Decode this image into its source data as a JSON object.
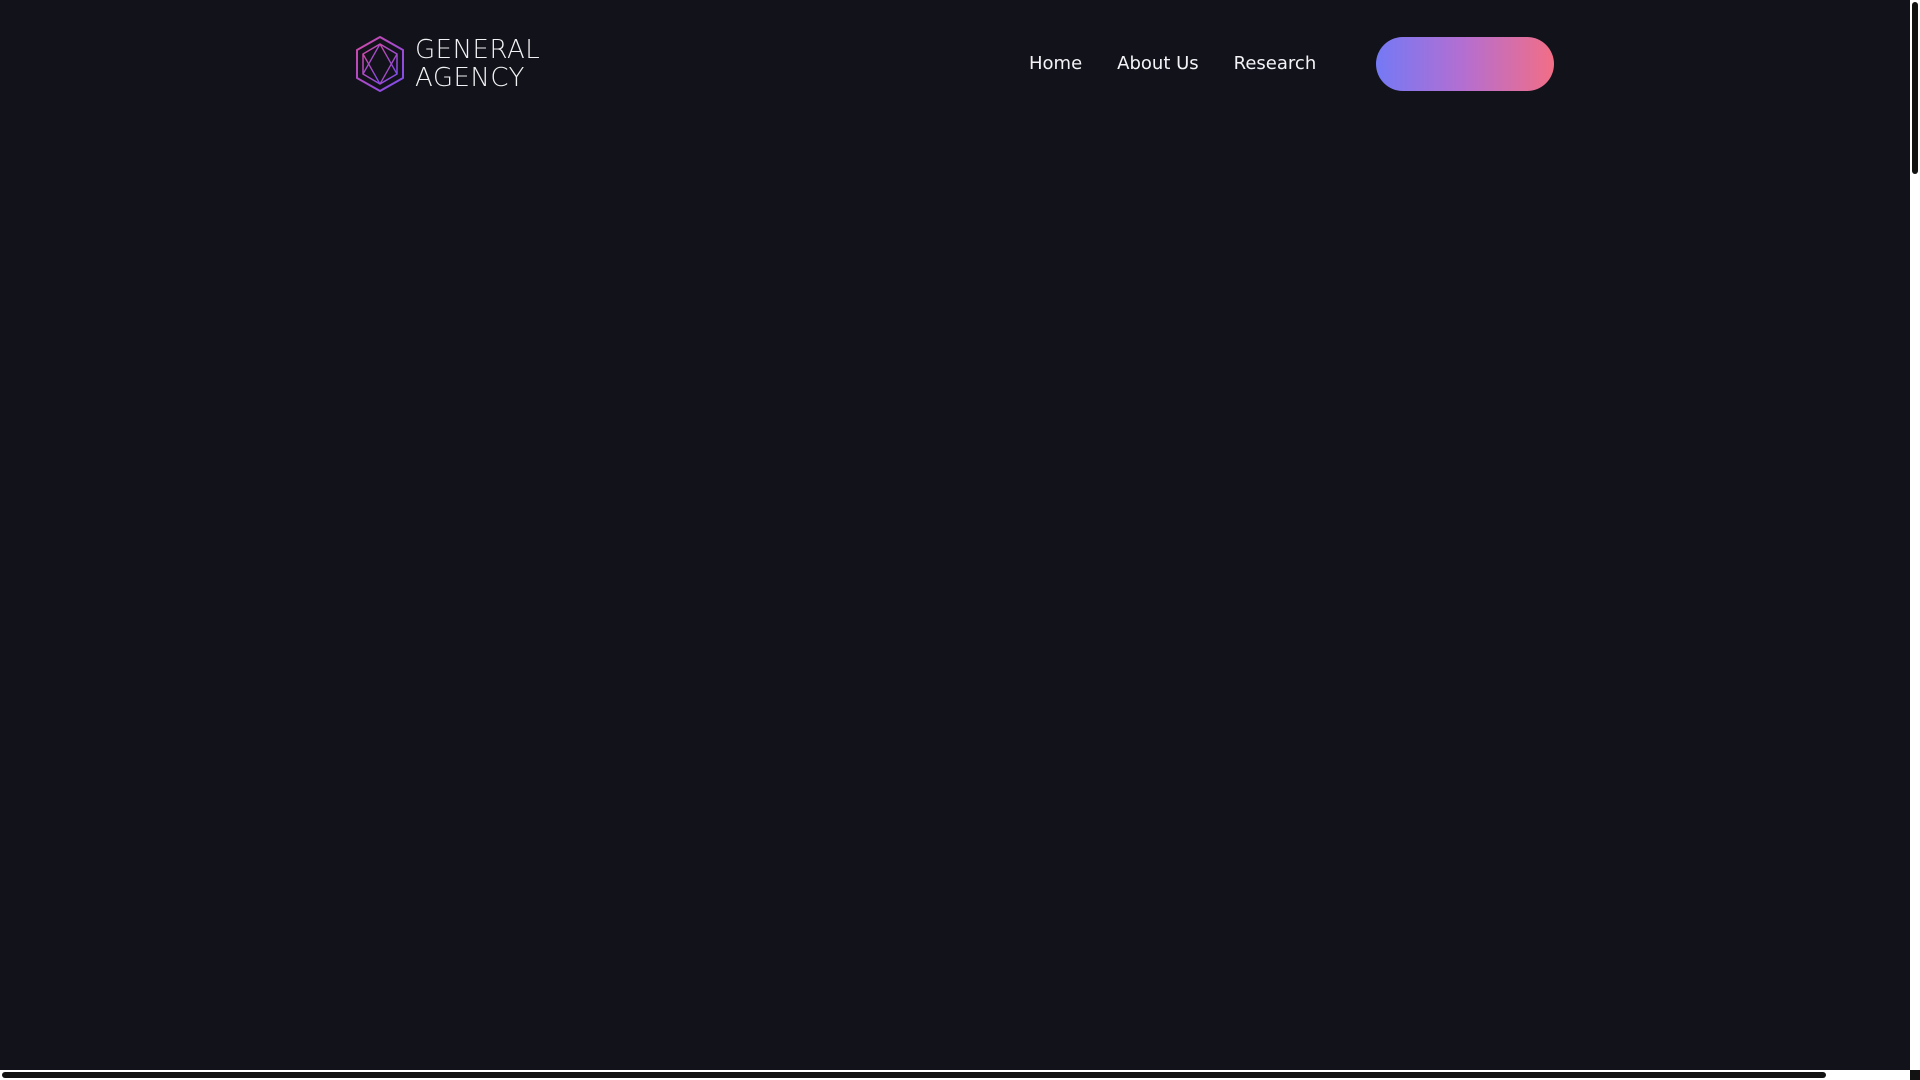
{
  "brand": {
    "name_line1": "GENERAL",
    "name_line2": "AGENCY",
    "logo_icon": "hexagon-cube-logo-icon",
    "logo_gradient": [
      "#7b4cf0",
      "#d24aa6"
    ]
  },
  "nav": {
    "items": [
      {
        "label": "Home"
      },
      {
        "label": "About Us"
      },
      {
        "label": "Research"
      }
    ]
  },
  "cta": {
    "label": "",
    "gradient": [
      "#7479f5",
      "#b56ed0",
      "#f26e86"
    ]
  },
  "theme": {
    "background": "#12121a",
    "text": "#f4f4f8"
  }
}
